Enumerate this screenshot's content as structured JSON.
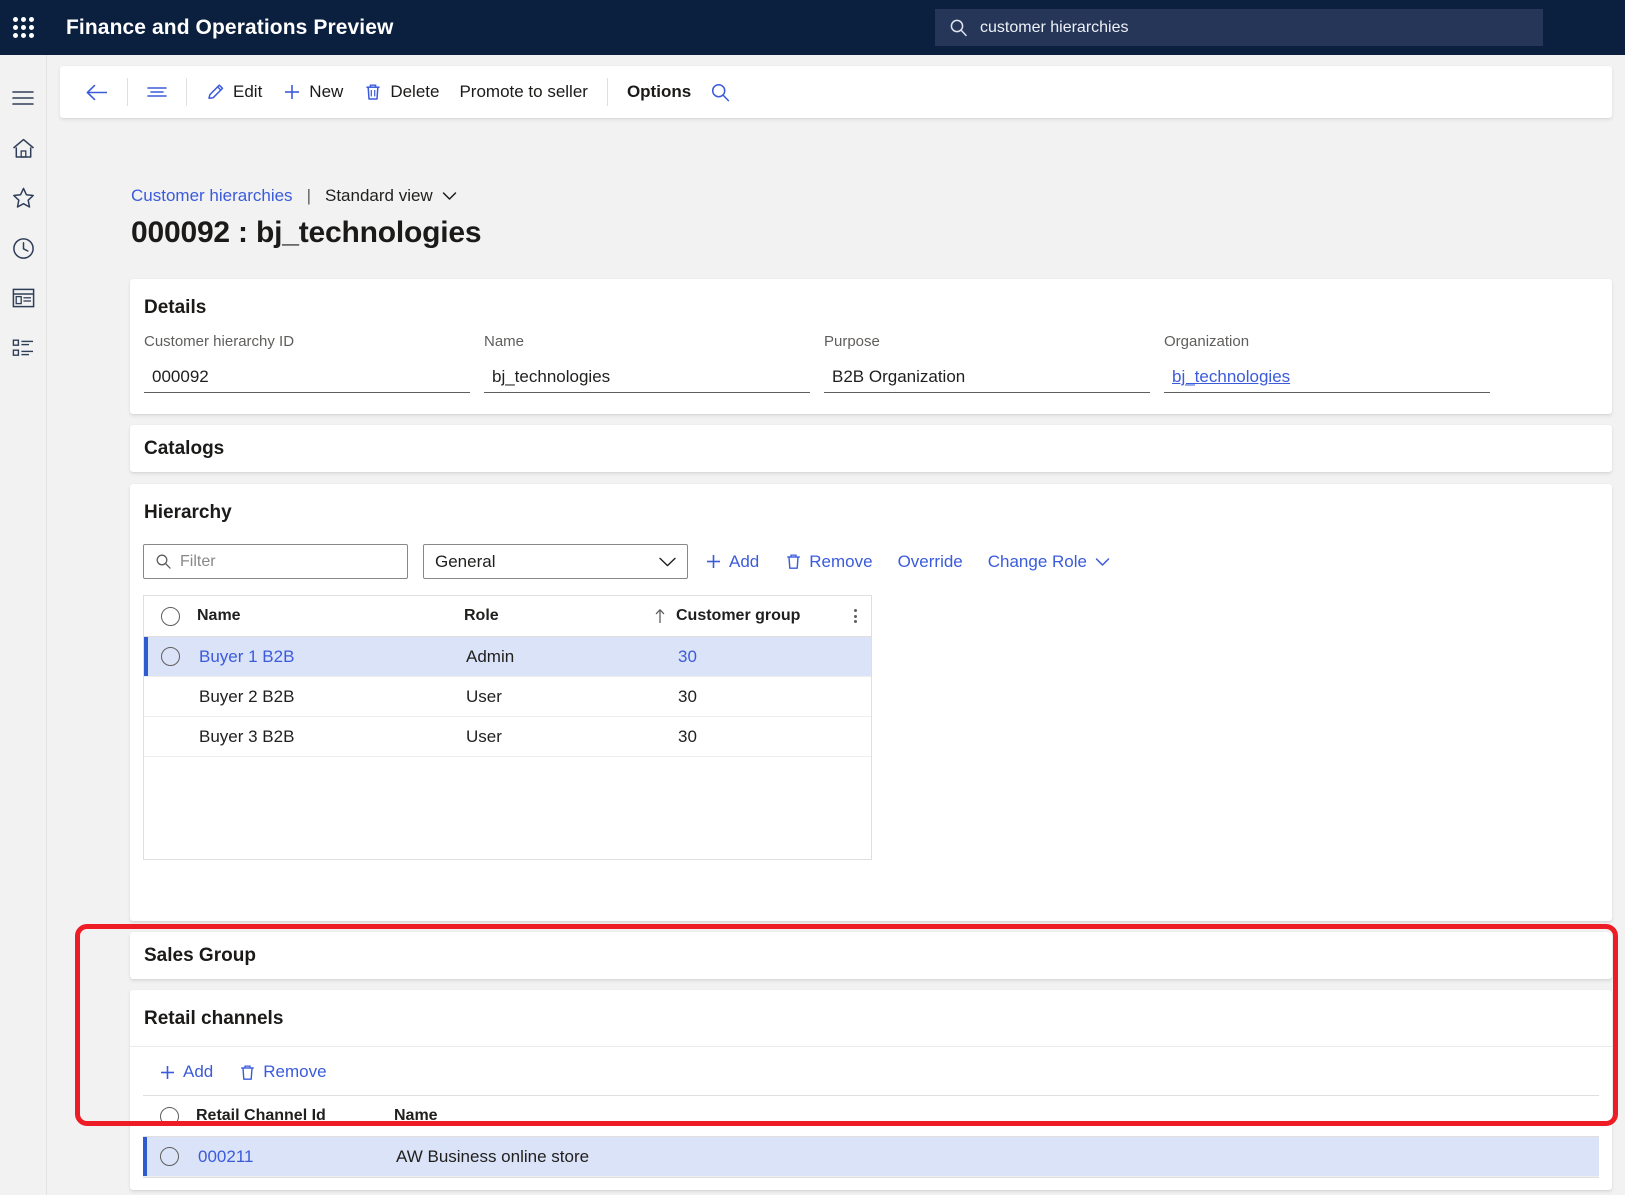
{
  "topbar": {
    "waffle_icon": "app-launcher-icon",
    "app_title": "Finance and Operations Preview",
    "search": {
      "icon": "search-icon",
      "value": "customer hierarchies"
    }
  },
  "rail": {
    "items": [
      {
        "icon": "hamburger-menu-icon",
        "name": "nav-expand"
      },
      {
        "icon": "home-icon",
        "name": "home"
      },
      {
        "icon": "star-icon",
        "name": "favorites"
      },
      {
        "icon": "clock-icon",
        "name": "recent"
      },
      {
        "icon": "workspace-icon",
        "name": "workspaces"
      },
      {
        "icon": "list-icon",
        "name": "modules"
      }
    ]
  },
  "action_pane": {
    "back_icon": "back-arrow-icon",
    "nav_icon": "show-navigation-icon",
    "buttons": [
      {
        "label": "Edit",
        "icon": "pencil-icon"
      },
      {
        "label": "New",
        "icon": "plus-icon"
      },
      {
        "label": "Delete",
        "icon": "trash-icon"
      },
      {
        "label": "Promote to seller",
        "icon": ""
      },
      {
        "label": "Options",
        "icon": ""
      }
    ],
    "search_icon": "search-icon"
  },
  "breadcrumb": {
    "parent": "Customer hierarchies",
    "separator": "|",
    "view": "Standard view",
    "view_chevron_icon": "chevron-down-icon"
  },
  "page_title": "000092 : bj_technologies",
  "details": {
    "section_title": "Details",
    "fields": [
      {
        "label": "Customer hierarchy ID",
        "value": "000092",
        "is_link": false
      },
      {
        "label": "Name",
        "value": "bj_technologies",
        "is_link": false
      },
      {
        "label": "Purpose",
        "value": "B2B Organization",
        "is_link": false
      },
      {
        "label": "Organization",
        "value": "bj_technologies",
        "is_link": true
      }
    ]
  },
  "catalogs": {
    "section_title": "Catalogs"
  },
  "hierarchy": {
    "section_title": "Hierarchy",
    "filter": {
      "icon": "search-icon",
      "placeholder": "Filter",
      "value": ""
    },
    "select": {
      "value": "General",
      "chevron_icon": "chevron-down-icon"
    },
    "toolbar": [
      {
        "label": "Add",
        "icon": "plus-icon"
      },
      {
        "label": "Remove",
        "icon": "trash-icon"
      },
      {
        "label": "Override",
        "icon": ""
      },
      {
        "label": "Change Role",
        "icon": "chevron-down-icon"
      }
    ],
    "columns": [
      "Name",
      "Role",
      "Customer group"
    ],
    "sort_indicator_icon": "sort-ascending-arrow-icon",
    "column_menu_icon": "column-options-icon",
    "rows": [
      {
        "name": "Buyer 1 B2B",
        "role": "Admin",
        "customer_group": "30",
        "selected": true
      },
      {
        "name": "Buyer 2 B2B",
        "role": "User",
        "customer_group": "30",
        "selected": false
      },
      {
        "name": "Buyer 3 B2B",
        "role": "User",
        "customer_group": "30",
        "selected": false
      }
    ]
  },
  "sales_group": {
    "section_title": "Sales Group"
  },
  "retail_channels": {
    "section_title": "Retail channels",
    "toolbar": [
      {
        "label": "Add",
        "icon": "plus-icon"
      },
      {
        "label": "Remove",
        "icon": "trash-icon"
      }
    ],
    "columns": [
      "Retail Channel Id",
      "Name"
    ],
    "rows": [
      {
        "retail_channel_id": "000211",
        "name": "AW Business online store",
        "selected": true
      }
    ]
  },
  "colors": {
    "topbar_bg": "#0b1f3f",
    "search_bg": "#253659",
    "link": "#3b5bdb",
    "row_selected_bg": "#dbe3f8",
    "row_selected_bar": "#2f5bd0",
    "annotation": "#ee1c25",
    "page_bg": "#f2f2f2"
  }
}
